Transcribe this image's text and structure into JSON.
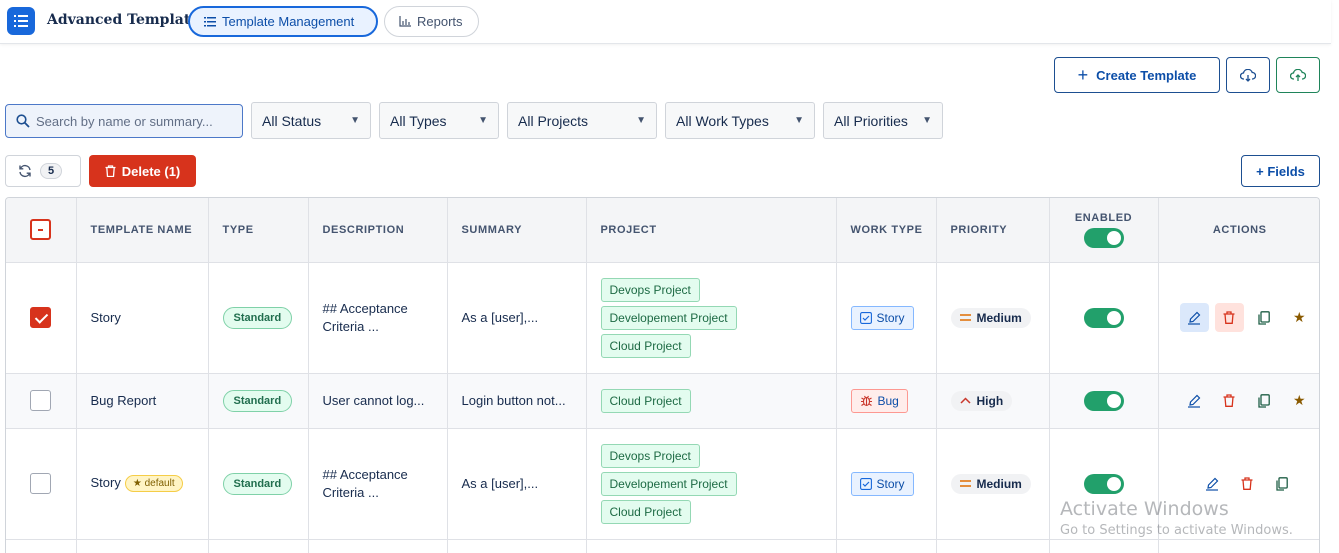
{
  "app": {
    "title": "Advanced Template"
  },
  "nav": {
    "tabs": [
      {
        "label": "Template Management",
        "active": true
      },
      {
        "label": "Reports",
        "active": false
      }
    ]
  },
  "toolbar": {
    "create_label": "Create Template",
    "delete_label": "Delete (1)",
    "fields_label": "+ Fields",
    "refresh_count": "5"
  },
  "filters": {
    "search_placeholder": "Search by name or summary...",
    "status": "All Status",
    "types": "All Types",
    "projects": "All Projects",
    "work_types": "All Work Types",
    "priorities": "All Priorities"
  },
  "table": {
    "headers": {
      "name": "TEMPLATE NAME",
      "type": "TYPE",
      "description": "DESCRIPTION",
      "summary": "SUMMARY",
      "project": "PROJECT",
      "work_type": "WORK TYPE",
      "priority": "PRIORITY",
      "enabled": "ENABLED",
      "actions": "ACTIONS"
    },
    "rows": [
      {
        "checked": true,
        "name": "Story",
        "default_badge": "",
        "type": "Standard",
        "description_l1": "## Acceptance",
        "description_l2": "Criteria ...",
        "summary": "As a [user],...",
        "projects": [
          "Devops Project",
          "Developement Project",
          "Cloud Project"
        ],
        "work_type": "Story",
        "work_type_icon": "story-icon",
        "priority": "Medium",
        "enabled": true,
        "starred": true
      },
      {
        "checked": false,
        "name": "Bug Report",
        "default_badge": "",
        "type": "Standard",
        "description_l1": "User cannot log...",
        "description_l2": "",
        "summary": "Login button not...",
        "projects": [
          "Cloud Project"
        ],
        "work_type": "Bug",
        "work_type_icon": "bug-icon",
        "priority": "High",
        "enabled": true,
        "starred": true
      },
      {
        "checked": false,
        "name": "Story",
        "default_badge": "★ default",
        "type": "Standard",
        "description_l1": "## Acceptance",
        "description_l2": "Criteria ...",
        "summary": "As a [user],...",
        "projects": [
          "Devops Project",
          "Developement Project",
          "Cloud Project"
        ],
        "work_type": "Story",
        "work_type_icon": "story-icon",
        "priority": "Medium",
        "enabled": true,
        "starred": false
      }
    ]
  },
  "watermark": {
    "line1": "Activate Windows",
    "line2": "Go to Settings to activate Windows."
  },
  "colors": {
    "accent": "#1868db",
    "danger": "#d7331c",
    "success": "#22a06b"
  }
}
